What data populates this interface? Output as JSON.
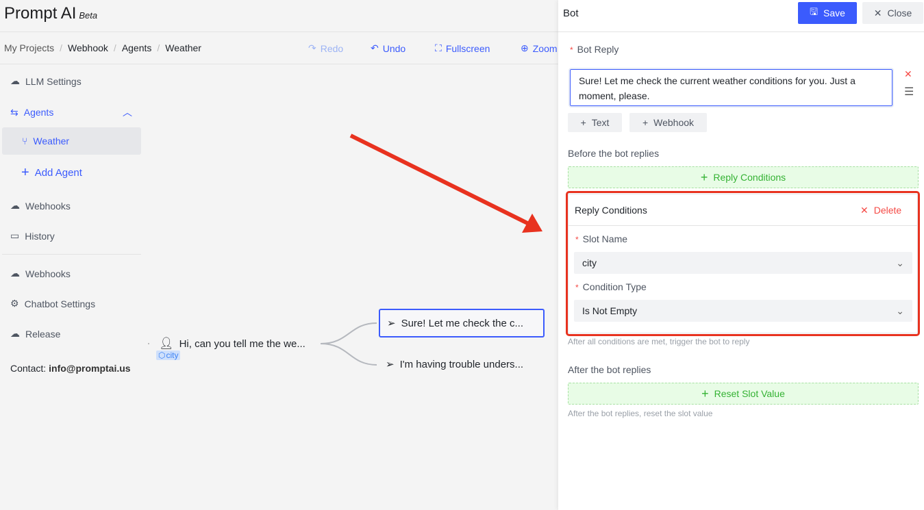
{
  "app": {
    "title": "Prompt AI",
    "badge": "Beta"
  },
  "breadcrumb": [
    "My Projects",
    "Webhook",
    "Agents",
    "Weather"
  ],
  "toolbar": {
    "redo": "Redo",
    "undo": "Undo",
    "fullscreen": "Fullscreen",
    "zoom": "Zoom"
  },
  "sidebar": {
    "llm": "LLM Settings",
    "agents": "Agents",
    "weather": "Weather",
    "add_agent": "Add Agent",
    "webhooks": "Webhooks",
    "history": "History",
    "webhooks2": "Webhooks",
    "chatbot_settings": "Chatbot Settings",
    "release": "Release",
    "contact_label": "Contact:",
    "contact_email": "info@promptai.us"
  },
  "canvas": {
    "user_node": "Hi, can you tell me the we...",
    "slot_tag": "city",
    "bot_node_1": "Sure! Let me check the c...",
    "bot_node_2": "I'm having trouble unders..."
  },
  "panel": {
    "title": "Bot",
    "save": "Save",
    "close": "Close",
    "bot_reply_label": "Bot Reply",
    "bot_reply_value": "Sure! Let me check the current weather conditions for you. Just a moment, please.",
    "add_text": "Text",
    "add_webhook": "Webhook",
    "before_label": "Before the bot replies",
    "reply_conditions_button": "Reply Conditions",
    "card": {
      "title": "Reply Conditions",
      "delete": "Delete",
      "slot_name_label": "Slot Name",
      "slot_name_value": "city",
      "condition_type_label": "Condition Type",
      "condition_type_value": "Is Not Empty"
    },
    "before_help": "After all conditions are met, trigger the bot to reply",
    "after_label": "After the bot replies",
    "reset_slot_button": "Reset Slot Value",
    "after_help": "After the bot replies, reset the slot value"
  },
  "colors": {
    "accent": "#3b5bfd",
    "danger": "#f54a45",
    "success": "#34b233",
    "annotation": "#e8321f"
  }
}
